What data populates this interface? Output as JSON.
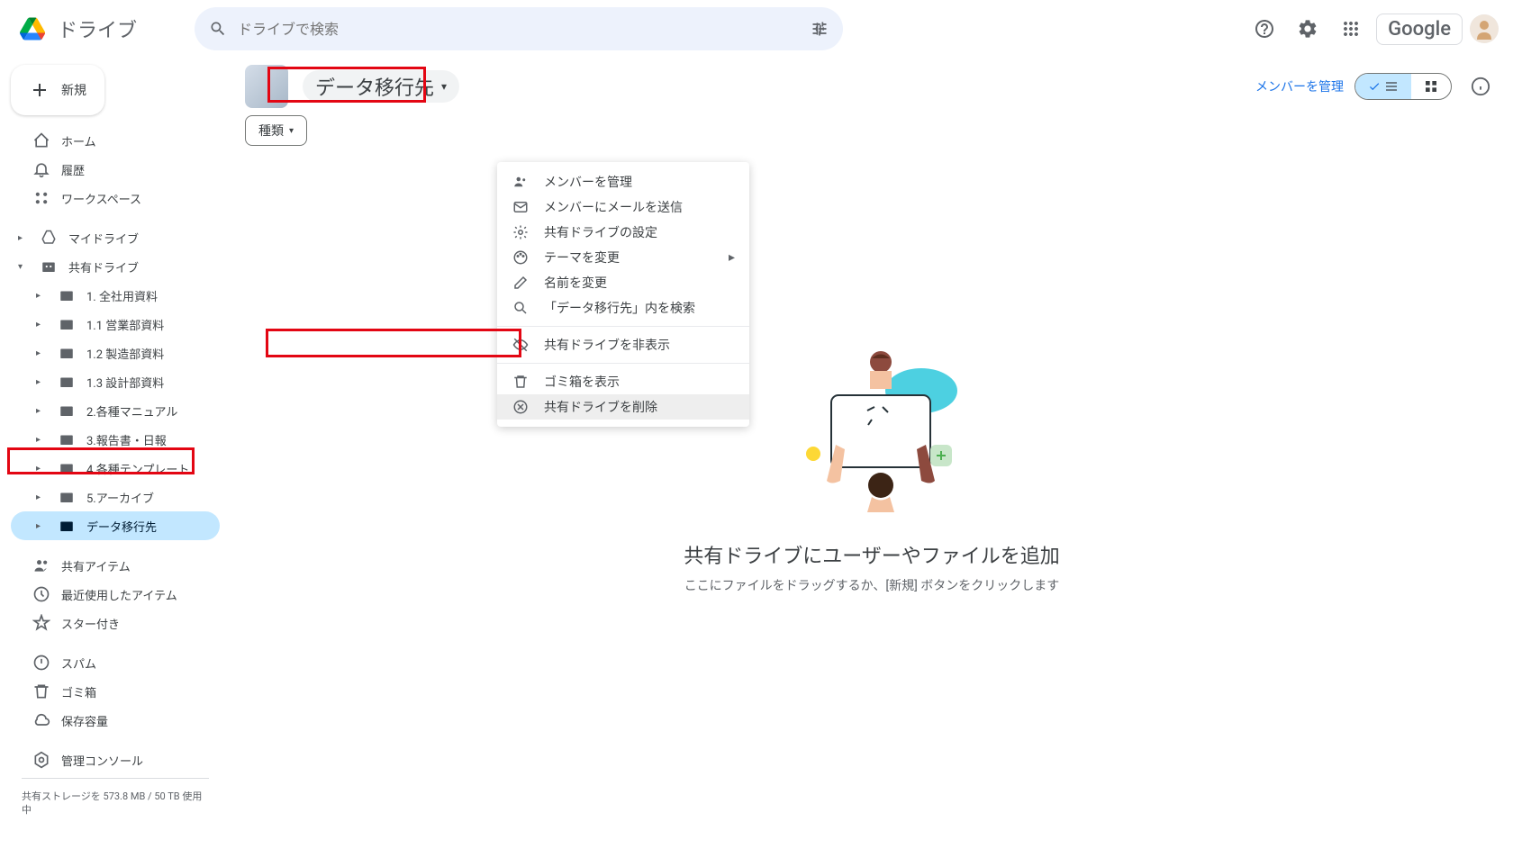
{
  "header": {
    "app_name": "ドライブ",
    "search_placeholder": "ドライブで検索",
    "google_label": "Google"
  },
  "sidebar": {
    "new_label": "新規",
    "nav_home": "ホーム",
    "nav_activity": "履歴",
    "nav_workspace": "ワークスペース",
    "my_drive": "マイドライブ",
    "shared_drives": "共有ドライブ",
    "drives": [
      "1. 全社用資料",
      "1.1 営業部資料",
      "1.2 製造部資料",
      "1.3 設計部資料",
      "2.各種マニュアル",
      "3.報告書・日報",
      "4.各種テンプレート",
      "5.アーカイブ",
      "データ移行先"
    ],
    "shared_with_me": "共有アイテム",
    "recent": "最近使用したアイテム",
    "starred": "スター付き",
    "spam": "スパム",
    "trash": "ゴミ箱",
    "storage": "保存容量",
    "admin_console": "管理コンソール",
    "storage_text": "共有ストレージを 573.8 MB / 50 TB 使用中"
  },
  "main": {
    "breadcrumb": "データ移行先",
    "manage_members": "メンバーを管理",
    "filter_type": "種類",
    "empty_title": "共有ドライブにユーザーやファイルを追加",
    "empty_sub": "ここにファイルをドラッグするか、[新規] ボタンをクリックします"
  },
  "context_menu": {
    "items": [
      "メンバーを管理",
      "メンバーにメールを送信",
      "共有ドライブの設定",
      "テーマを変更",
      "名前を変更",
      "「データ移行先」内を検索",
      "共有ドライブを非表示",
      "ゴミ箱を表示",
      "共有ドライブを削除"
    ]
  }
}
